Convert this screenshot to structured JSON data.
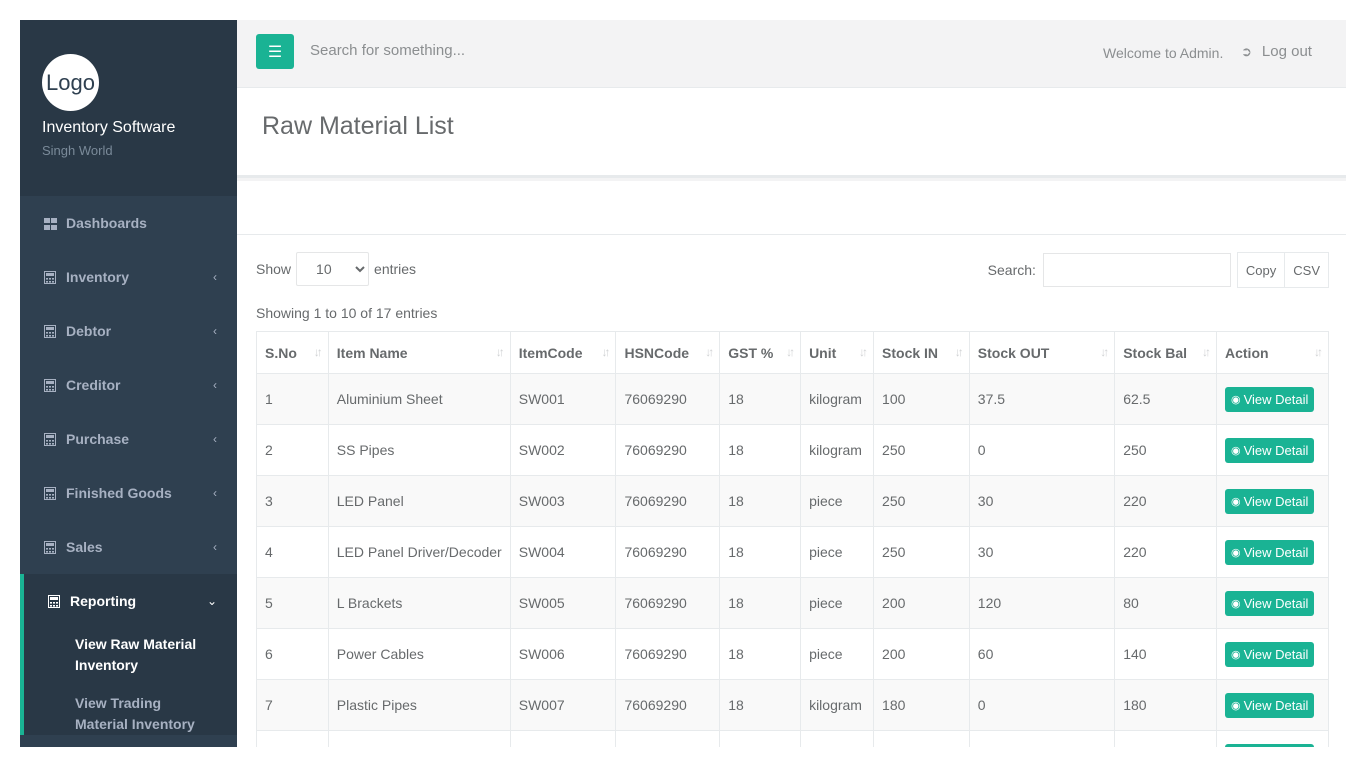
{
  "brand": {
    "logo_text": "Logo",
    "app_name": "Inventory Software",
    "company": "Singh World"
  },
  "sidebar": {
    "items": [
      {
        "label": "Dashboards",
        "icon": "dashboard-grid-icon",
        "has_chevron": false
      },
      {
        "label": "Inventory",
        "icon": "calculator-icon",
        "has_chevron": true
      },
      {
        "label": "Debtor",
        "icon": "calculator-icon",
        "has_chevron": true
      },
      {
        "label": "Creditor",
        "icon": "calculator-icon",
        "has_chevron": true
      },
      {
        "label": "Purchase",
        "icon": "calculator-icon",
        "has_chevron": true
      },
      {
        "label": "Finished Goods",
        "icon": "calculator-icon",
        "has_chevron": true
      },
      {
        "label": "Sales",
        "icon": "calculator-icon",
        "has_chevron": true
      },
      {
        "label": "Reporting",
        "icon": "calculator-icon",
        "has_chevron": true,
        "active": true
      }
    ],
    "reporting_sub": [
      {
        "label": "View Raw Material Inventory"
      },
      {
        "label": "View Trading Material Inventory"
      }
    ]
  },
  "topbar": {
    "menu_icon": "hamburger-icon",
    "search_placeholder": "Search for something...",
    "welcome": "Welcome to Admin.",
    "logout": "Log out"
  },
  "page": {
    "title": "Raw Material List"
  },
  "table_controls": {
    "show_label": "Show",
    "entries_label": "entries",
    "page_size": "10",
    "search_label": "Search:",
    "copy_label": "Copy",
    "csv_label": "CSV",
    "info": "Showing 1 to 10 of 17 entries"
  },
  "table": {
    "columns": [
      "S.No",
      "Item Name",
      "ItemCode",
      "HSNCode",
      "GST %",
      "Unit",
      "Stock IN",
      "Stock OUT",
      "Stock Bal",
      "Action"
    ],
    "action_label": "View Detail",
    "rows": [
      [
        "1",
        "Aluminium Sheet",
        "SW001",
        "76069290",
        "18",
        "kilogram",
        "100",
        "37.5",
        "62.5"
      ],
      [
        "2",
        "SS Pipes",
        "SW002",
        "76069290",
        "18",
        "kilogram",
        "250",
        "0",
        "250"
      ],
      [
        "3",
        "LED Panel",
        "SW003",
        "76069290",
        "18",
        "piece",
        "250",
        "30",
        "220"
      ],
      [
        "4",
        "LED Panel Driver/Decoder",
        "SW004",
        "76069290",
        "18",
        "piece",
        "250",
        "30",
        "220"
      ],
      [
        "5",
        "L Brackets",
        "SW005",
        "76069290",
        "18",
        "piece",
        "200",
        "120",
        "80"
      ],
      [
        "6",
        "Power Cables",
        "SW006",
        "76069290",
        "18",
        "piece",
        "200",
        "60",
        "140"
      ],
      [
        "7",
        "Plastic Pipes",
        "SW007",
        "76069290",
        "18",
        "kilogram",
        "180",
        "0",
        "180"
      ],
      [
        "",
        "",
        "",
        "",
        "",
        "",
        "",
        "",
        ""
      ]
    ]
  },
  "colors": {
    "accent": "#1ab394",
    "sidebar_bg": "#2f4050",
    "sidebar_dark": "#293846",
    "text": "#676a6c"
  }
}
